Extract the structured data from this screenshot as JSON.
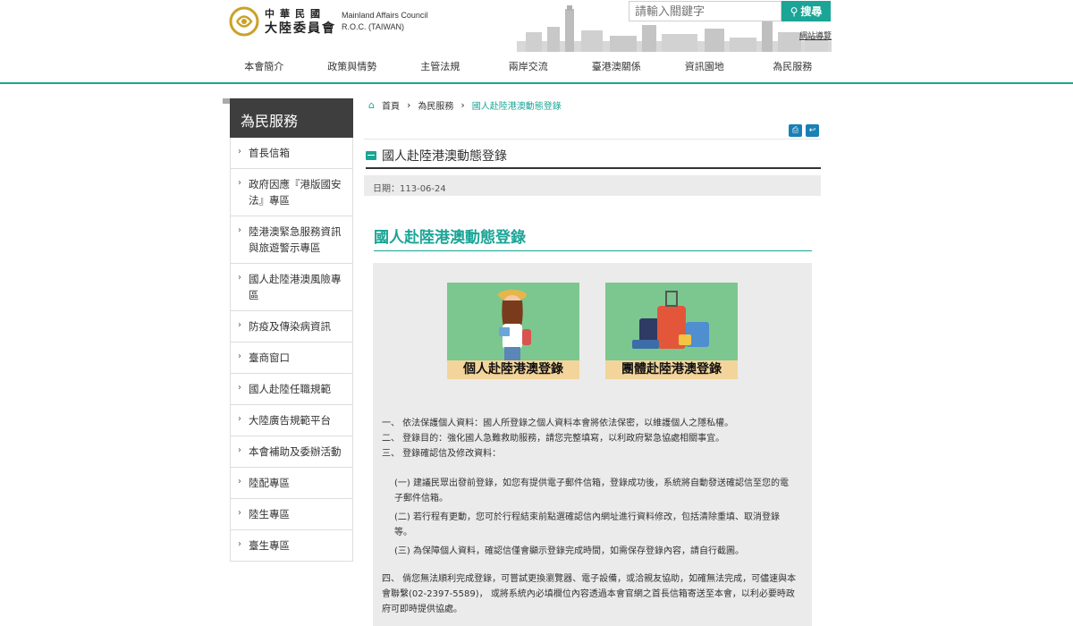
{
  "header": {
    "logo_cn_line1": "中華民國",
    "logo_cn_line2": "大陸委員會",
    "logo_en_line1": "Mainland Affairs Council",
    "logo_en_line2": "R.O.C. (TAIWAN)",
    "search_placeholder": "請輸入關鍵字",
    "search_button": "搜尋",
    "sitemap": "網站導覽"
  },
  "nav": [
    "本會簡介",
    "政策與情勢",
    "主管法規",
    "兩岸交流",
    "臺港澳關係",
    "資訊園地",
    "為民服務"
  ],
  "sidebar": {
    "title": "為民服務",
    "items": [
      "首長信箱",
      "政府因應『港版國安法』專區",
      "陸港澳緊急服務資訊與旅遊警示專區",
      "國人赴陸港澳風險專區",
      "防疫及傳染病資訊",
      "臺商窗口",
      "國人赴陸任職規範",
      "大陸廣告規範平台",
      "本會補助及委辦活動",
      "陸配專區",
      "陸生專區",
      "臺生專區"
    ]
  },
  "breadcrumb": [
    "首頁",
    "為民服務",
    "國人赴陸港澳動態登錄"
  ],
  "page_title": "國人赴陸港澳動態登錄",
  "date": "日期：113-06-24",
  "article_title": "國人赴陸港澳動態登錄",
  "cards": [
    "個人赴陸港澳登錄",
    "團體赴陸港澳登錄"
  ],
  "content": {
    "p1": "一、 依法保護個人資料：國人所登錄之個人資料本會將依法保密，以維護個人之隱私權。",
    "p2": "二、 登錄目的：強化國人急難救助服務，請您完整填寫，以利政府緊急協處相關事宜。",
    "p3": "三、 登錄確認信及修改資料：",
    "s1": "(一) 建議民眾出發前登錄，如您有提供電子郵件信箱，登錄成功後，系統將自動發送確認信至您的電子郵件信箱。",
    "s2": "(二) 若行程有更動，您可於行程結束前點選確認信內網址進行資料修改，包括清除重填、取消登錄等。",
    "s3": "(三) 為保障個人資料，確認信僅會顯示登錄完成時間，如需保存登錄內容，請自行截圖。",
    "p4": "四、 倘您無法順利完成登錄，可嘗試更換瀏覽器、電子設備，或洽親友協助，如確無法完成，可儘速與本會聯繫(02-2397-5589)， 或將系統內必填欄位內容透過本會官網之首長信箱寄送至本會，以利必要時政府可即時提供協處。"
  },
  "colors": {
    "accent": "#1aa596",
    "sidebar_head": "#3e3e3e",
    "card_green": "#7cc78f",
    "card_label": "#f3d59b"
  }
}
